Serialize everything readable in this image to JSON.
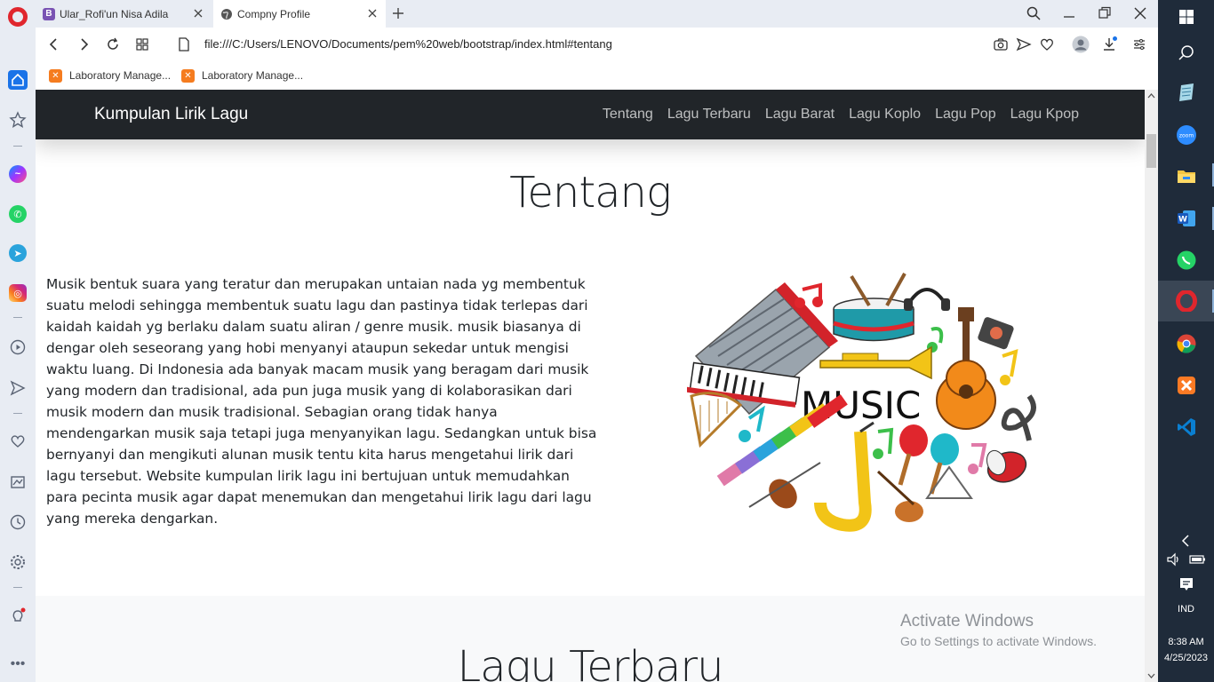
{
  "browser": {
    "tabs": [
      {
        "label": "Ular_Rofi'un Nisa Adila",
        "favicon": "bootstrap-icon",
        "active": false
      },
      {
        "label": "Compny Profile",
        "favicon": "globe-icon",
        "active": true
      }
    ],
    "url": "file:///C:/Users/LENOVO/Documents/pem%20web/bootstrap/index.html#tentang",
    "bookmarks": [
      {
        "label": "Laboratory Manage..."
      },
      {
        "label": "Laboratory Manage..."
      }
    ]
  },
  "page": {
    "brand": "Kumpulan Lirik Lagu",
    "nav": [
      "Tentang",
      "Lagu Terbaru",
      "Lagu Barat",
      "Lagu Koplo",
      "Lagu Pop",
      "Lagu Kpop"
    ],
    "about_title": "Tentang",
    "about_paragraph": "Musik bentuk suara yang teratur dan merupakan untaian nada yg membentuk suatu melodi sehingga membentuk suatu lagu dan pastinya tidak terlepas dari kaidah kaidah yg berlaku dalam suatu aliran / genre musik. musik biasanya di dengar oleh seseorang yang hobi menyanyi ataupun sekedar untuk mengisi waktu luang. Di Indonesia ada banyak macam musik yang beragam dari musik yang modern dan tradisional, ada pun juga musik yang di kolaborasikan dari musik modern dan musik tradisional. Sebagian orang tidak hanya mendengarkan musik saja tetapi juga menyanyikan lagu. Sedangkan untuk bisa bernyanyi dan mengikuti alunan musik tentu kita harus mengetahui lirik dari lagu tersebut. Website kumpulan lirik lagu ini bertujuan untuk memudahkan para pecinta musik agar dapat menemukan dan mengetahui lirik lagu dari lagu yang mereka dengarkan.",
    "image_text": "MUSIC",
    "latest_title": "Lagu Terbaru"
  },
  "watermark": {
    "line1": "Activate Windows",
    "line2": "Go to Settings to activate Windows."
  },
  "taskbar": {
    "language": "IND",
    "time": "8:38 AM",
    "date": "4/25/2023"
  },
  "colors": {
    "navbar": "#212529",
    "taskbar": "#1f2b3a",
    "opera_red": "#e0262d"
  }
}
